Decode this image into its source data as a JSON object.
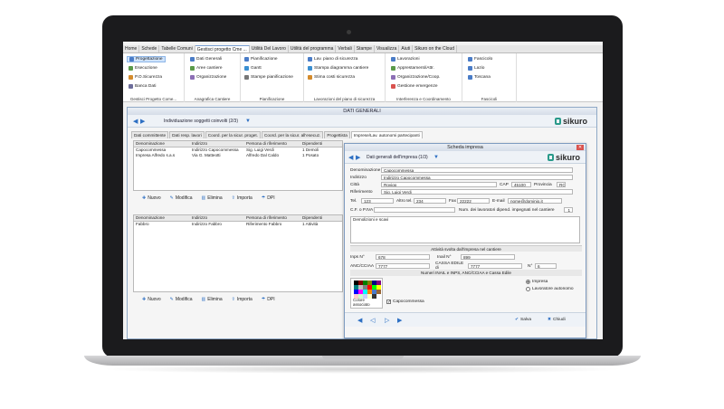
{
  "tabs": [
    "Home",
    "Schede",
    "Tabelle Comuni",
    "Gestisci progetto Cme ...",
    "Utilità Del Lavoro",
    "Utilità del programma",
    "Verbali",
    "Stampe",
    "Visualizza",
    "Aiuti",
    "Sikuro on the Cloud"
  ],
  "ribbon": {
    "g1": {
      "items": [
        "Progettazione",
        "Esecuzione",
        "P.O.Sicurezza",
        "Banca Dati"
      ],
      "label": "Gestisci Progetto Come..."
    },
    "g2": {
      "items": [
        "Dati Generali",
        "Aree cantiere",
        "Organizzazione"
      ],
      "label": "Anagrafica Cantiere"
    },
    "g3": {
      "items": [
        "Pianificazione",
        "Gantt",
        "Stampe pianificazione"
      ],
      "label": "Pianificazione"
    },
    "g4": {
      "items": [
        "Lav. piano di sicurezza",
        "Stampa diagramma cantiere",
        "Stima costi sicurezza"
      ],
      "label": "Lavorazioni del piano di sicurezza"
    },
    "g5": {
      "items": [
        "Lavorazioni",
        "Apprestamenti/Attr.",
        "Organizzazione/Coop.",
        "Gestione emergenze"
      ],
      "label": "Interferenza e Coordinamento"
    },
    "g6": {
      "items": [
        "Fascicolo",
        "Lazio",
        "Toscana"
      ],
      "label": "Fascicoli"
    }
  },
  "main": {
    "title": "DATI GENERALI",
    "nav_title": "Individuazione soggetti coinvolti (2/3)",
    "logo": "sikuro",
    "subtabs": [
      "Dati committente",
      "Dati resp. lavori",
      "Coord. per la sicur. proget.",
      "Coord. per la sicur. all'esecuz.",
      "Progettista",
      "Imprese/Lav. autonomi partecipanti"
    ],
    "grid1": {
      "headers": [
        "Denominazione",
        "Indirizzo",
        "Persona di riferimento",
        "Dipendenti"
      ],
      "rows": [
        [
          "Capocommessa",
          "Indirizzo Capocommessa",
          "Sig. Luigi Verdi",
          "1 Demoli"
        ],
        [
          "Impresa Alfredo s.a.s",
          "Via G. Matteotti",
          "Alfredo Dal Caldo",
          "1 Posato"
        ]
      ]
    },
    "grid2": {
      "headers": [
        "Denominazione",
        "Indirizzo",
        "Persona di riferimento",
        "Dipendenti"
      ],
      "rows": [
        [
          "Fabbro",
          "Indirizzo Fabbro",
          "Riferimento Fabbro",
          "1 Attività"
        ]
      ]
    },
    "toolbar": {
      "nuovo": "Nuovo",
      "modifica": "Modifica",
      "elimina": "Elimina",
      "importa": "Importa",
      "dpi": "DPI"
    }
  },
  "dialog": {
    "title": "Scheda impresa",
    "nav_title": "Dati generali dell'impresa (1/3)",
    "logo": "sikuro",
    "denominazione_label": "Denominazione",
    "denominazione": "Capocommessa",
    "indirizzo_label": "Indirizzo",
    "indirizzo": "Indirizzo Capocommessa",
    "citta_label": "Città",
    "citta": "Rovigo",
    "cap_label": "CAP",
    "cap": "45100",
    "provincia_label": "Provincia",
    "provincia": "RO",
    "riferimento_label": "Riferimento",
    "riferimento": "Sig. Luigi Verdi",
    "tel_label": "Tel.",
    "tel": "123",
    "altro_tel_label": "Altro tel.",
    "altro_tel": "234",
    "fax_label": "Fax",
    "fax": "22222",
    "email_label": "E-mail",
    "email": "nome@dominio.it",
    "cf_label": "C.F. o P.IVA",
    "num_lav_label": "Num. dei lavoratori dipend. impegnati nel cantiere",
    "num_lav": "1",
    "descrizione": "Demolizioni e scavi",
    "attivita_section": "Attività svolta dall'impresa nel cantiere",
    "inps_label": "Inps N°",
    "inps": "678",
    "inail_label": "Inail N°",
    "inail": "899",
    "anc_label": "ANC/CCIAA",
    "anc": "7777",
    "cassa_label": "CASSA EDILE di",
    "cassa": "7777",
    "n_label": "N°",
    "n": "6",
    "numeri_section": "Numeri INAIL e INPS, ANC/CCIAA e Cassa Edile",
    "colore_label": "Colore associato",
    "capocommessa_label": "Capocommessa",
    "radio_impresa": "Impresa",
    "radio_lavoratore": "Lavoratore autonomo",
    "salva": "Salva",
    "chiudi": "Chiudi"
  },
  "colors": {
    "accent": "#2d6fc3",
    "brand": "#2a9a8a"
  }
}
